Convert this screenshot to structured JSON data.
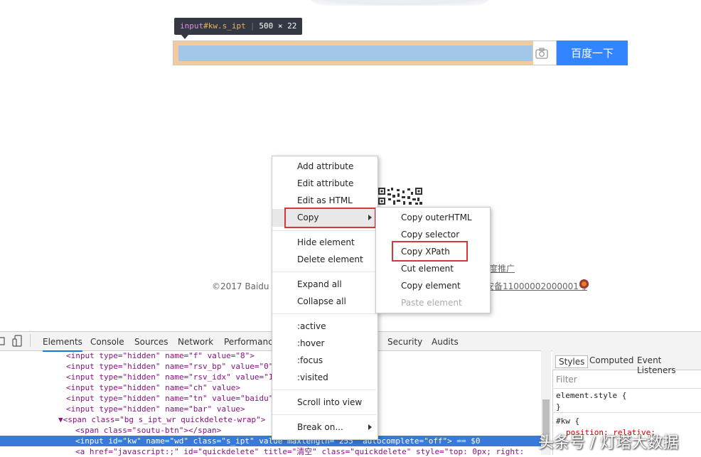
{
  "tooltip": {
    "tag": "input",
    "id": "#kw",
    "class": ".s_ipt",
    "size": "500 × 22"
  },
  "search": {
    "button_label": "百度一下"
  },
  "footer": {
    "links": "度推广",
    "copyright": "©2017 Baidu 使",
    "beian": "安备11000002000001号"
  },
  "devtools": {
    "tabs": [
      "Elements",
      "Console",
      "Sources",
      "Network",
      "Performance",
      "Security",
      "Audits"
    ],
    "code_lines": [
      "<input type=\"hidden\" name=\"f\" value=\"8\">",
      "<input type=\"hidden\" name=\"rsv_bp\" value=\"0\"",
      "<input type=\"hidden\" name=\"rsv_idx\" value=\"1",
      "<input type=\"hidden\" name=\"ch\" value>",
      "<input type=\"hidden\" name=\"tn\" value=\"baidu\"",
      "<input type=\"hidden\" name=\"bar\" value>",
      "▼<span class=\"bg s_ipt_wr quickdelete-wrap\">",
      "<span class=\"soutu-btn\"></span>",
      "<input id=\"kw\" name=\"wd\" class=\"s_ipt\" value maxlength=\"255\" autocomplete=\"off\"> == $0",
      "<a href=\"javascript:;\" id=\"quickdelete\" title=\"清空\" class=\"quickdelete\" style=\"top: 0px; right:"
    ],
    "styles_tabs": [
      "Styles",
      "Computed",
      "Event Listeners"
    ],
    "filter_placeholder": "Filter",
    "styles_lines": [
      "element.style {",
      "}",
      "#kw {",
      "position: relative;"
    ]
  },
  "context_menu": {
    "items": [
      "Add attribute",
      "Edit attribute",
      "Edit as HTML",
      "Copy",
      "Hide element",
      "Delete element",
      "Expand all",
      "Collapse all",
      ":active",
      ":hover",
      ":focus",
      ":visited",
      "Scroll into view",
      "Break on..."
    ]
  },
  "copy_submenu": {
    "items": [
      "Copy outerHTML",
      "Copy selector",
      "Copy XPath",
      "Cut element",
      "Copy element",
      "Paste element"
    ]
  },
  "watermark": "头条号 / 灯塔大数据",
  "colors": {
    "search_button": "#3385ff",
    "selection": "#3879d9",
    "highlight_box": "#d43838"
  }
}
